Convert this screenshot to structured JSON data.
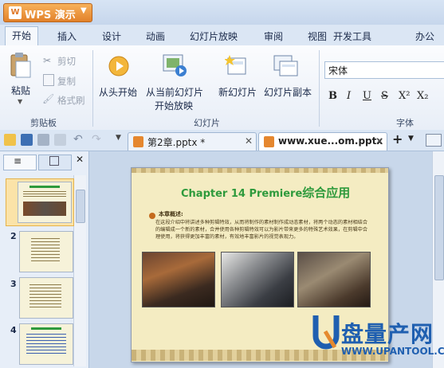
{
  "app": {
    "name": "WPS 演示",
    "logo": "W"
  },
  "tabs": [
    "开始",
    "插入",
    "设计",
    "动画",
    "幻灯片放映",
    "审阅",
    "视图",
    "开发工具",
    "办公"
  ],
  "active_tab": "开始",
  "ribbon": {
    "clipboard": {
      "label": "剪贴板",
      "paste": "粘贴",
      "cut": "剪切",
      "copy": "复制",
      "format_painter": "格式刷"
    },
    "slides": {
      "label": "幻灯片",
      "from_start": "从头开始",
      "from_current_line1": "从当前幻灯片",
      "from_current_line2": "开始放映",
      "new_slide": "新幻灯片",
      "duplicate_slide": "幻灯片副本"
    },
    "font": {
      "label": "字体",
      "font_name": "宋体",
      "bold": "B",
      "italic": "I",
      "underline": "U",
      "strike": "S",
      "superscript": "X²",
      "subscript": "X₂"
    }
  },
  "doc_tabs": [
    {
      "title": "第2章.pptx *",
      "active": false
    },
    {
      "title": "www.xue...om.pptx",
      "active": true
    }
  ],
  "thumbnails": [
    {
      "number": "1"
    },
    {
      "number": "2"
    },
    {
      "number": "3"
    },
    {
      "number": "4"
    }
  ],
  "slide": {
    "title_en": "Chapter 14  Premiere",
    "title_cn": "综合应用",
    "heading": "本章概述:",
    "body": "在这段介绍中将讲述多种剪辑特效，从而将制作的素材制作成动态素材，将两个动态的素材相结合的编辑成一个新的素材，合并使用各种剪辑特效可以为影片带来更多的特殊艺术效果，在剪辑中合理使用，将获得更加丰富的素材，有效地丰富影片的视觉表现力。"
  },
  "watermark": {
    "brand": "盘量产网",
    "url": "WWW.UPANTOOL.COM"
  },
  "colors": {
    "accent_orange": "#e58a2f",
    "slide_title_green": "#2e9a3c",
    "watermark_blue": "#1f5fb0"
  }
}
